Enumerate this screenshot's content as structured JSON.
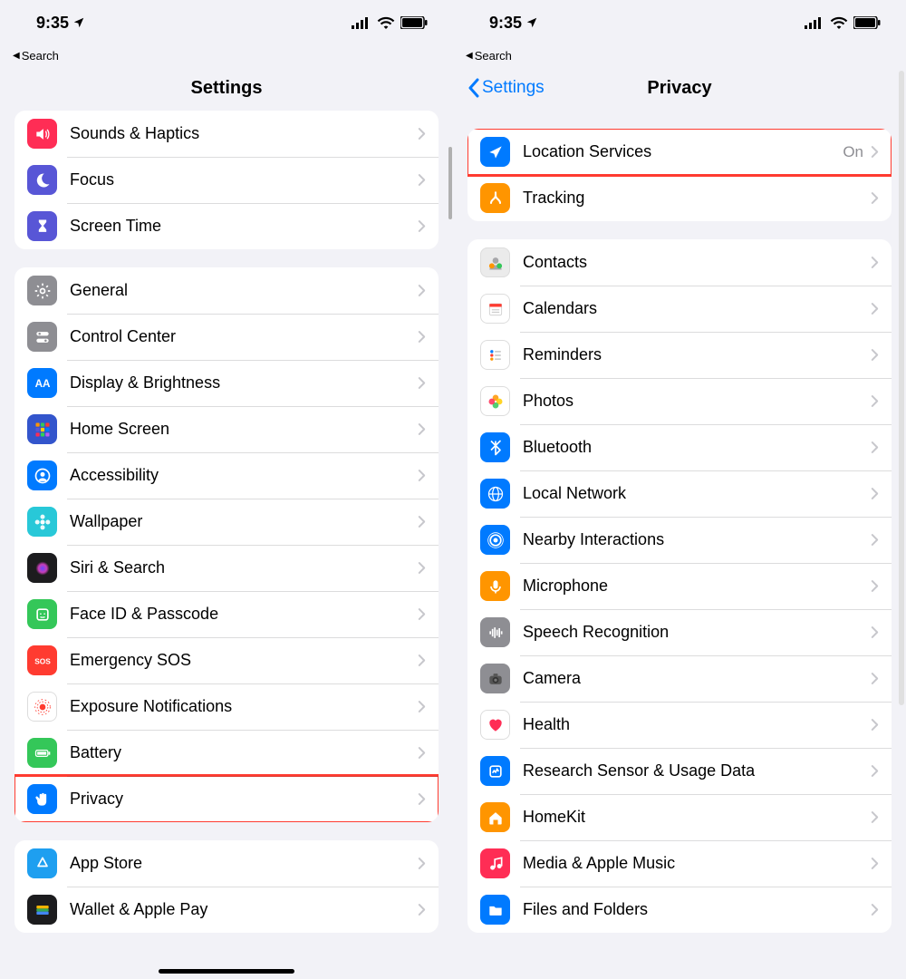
{
  "status": {
    "time": "9:35",
    "back_search": "Search"
  },
  "left": {
    "title": "Settings",
    "groups": [
      {
        "rows": [
          {
            "id": "sounds-haptics",
            "label": "Sounds & Haptics",
            "icon_bg": "#ff2d55",
            "icon": "speaker"
          },
          {
            "id": "focus",
            "label": "Focus",
            "icon_bg": "#5856d6",
            "icon": "moon"
          },
          {
            "id": "screen-time",
            "label": "Screen Time",
            "icon_bg": "#5856d6",
            "icon": "hourglass"
          }
        ]
      },
      {
        "rows": [
          {
            "id": "general",
            "label": "General",
            "icon_bg": "#8e8e93",
            "icon": "gear"
          },
          {
            "id": "control-center",
            "label": "Control Center",
            "icon_bg": "#8e8e93",
            "icon": "toggles"
          },
          {
            "id": "display-brightness",
            "label": "Display & Brightness",
            "icon_bg": "#007aff",
            "icon": "aa"
          },
          {
            "id": "home-screen",
            "label": "Home Screen",
            "icon_bg": "#3355cc",
            "icon": "apps"
          },
          {
            "id": "accessibility",
            "label": "Accessibility",
            "icon_bg": "#007aff",
            "icon": "person-circle"
          },
          {
            "id": "wallpaper",
            "label": "Wallpaper",
            "icon_bg": "#28c8d8",
            "icon": "flower"
          },
          {
            "id": "siri-search",
            "label": "Siri & Search",
            "icon_bg": "#1c1c1e",
            "icon": "siri"
          },
          {
            "id": "faceid-passcode",
            "label": "Face ID & Passcode",
            "icon_bg": "#34c759",
            "icon": "face"
          },
          {
            "id": "emergency-sos",
            "label": "Emergency SOS",
            "icon_bg": "#ff3b30",
            "icon": "sos"
          },
          {
            "id": "exposure-notifications",
            "label": "Exposure Notifications",
            "icon_bg": "#ffffff",
            "icon": "exposure"
          },
          {
            "id": "battery",
            "label": "Battery",
            "icon_bg": "#34c759",
            "icon": "battery"
          },
          {
            "id": "privacy",
            "label": "Privacy",
            "icon_bg": "#007aff",
            "icon": "hand",
            "highlighted": true
          }
        ]
      },
      {
        "rows": [
          {
            "id": "app-store",
            "label": "App Store",
            "icon_bg": "#1e9ff0",
            "icon": "appstore"
          },
          {
            "id": "wallet-applepay",
            "label": "Wallet & Apple Pay",
            "icon_bg": "#1c1c1e",
            "icon": "wallet"
          }
        ]
      }
    ]
  },
  "right": {
    "title": "Privacy",
    "back_label": "Settings",
    "groups": [
      {
        "rows": [
          {
            "id": "location-services",
            "label": "Location Services",
            "value": "On",
            "icon_bg": "#007aff",
            "icon": "location",
            "highlighted": true
          },
          {
            "id": "tracking",
            "label": "Tracking",
            "icon_bg": "#ff9500",
            "icon": "tracking"
          }
        ]
      },
      {
        "rows": [
          {
            "id": "contacts",
            "label": "Contacts",
            "icon_bg": "#ebebeb",
            "icon": "contacts"
          },
          {
            "id": "calendars",
            "label": "Calendars",
            "icon_bg": "#ffffff",
            "icon": "calendar"
          },
          {
            "id": "reminders",
            "label": "Reminders",
            "icon_bg": "#ffffff",
            "icon": "reminders"
          },
          {
            "id": "photos",
            "label": "Photos",
            "icon_bg": "#ffffff",
            "icon": "photos"
          },
          {
            "id": "bluetooth",
            "label": "Bluetooth",
            "icon_bg": "#007aff",
            "icon": "bluetooth"
          },
          {
            "id": "local-network",
            "label": "Local Network",
            "icon_bg": "#007aff",
            "icon": "globe"
          },
          {
            "id": "nearby-interactions",
            "label": "Nearby Interactions",
            "icon_bg": "#007aff",
            "icon": "nearby"
          },
          {
            "id": "microphone",
            "label": "Microphone",
            "icon_bg": "#ff9500",
            "icon": "mic"
          },
          {
            "id": "speech-recognition",
            "label": "Speech Recognition",
            "icon_bg": "#8e8e93",
            "icon": "wave"
          },
          {
            "id": "camera",
            "label": "Camera",
            "icon_bg": "#8e8e93",
            "icon": "camera"
          },
          {
            "id": "health",
            "label": "Health",
            "icon_bg": "#ffffff",
            "icon": "heart"
          },
          {
            "id": "research-sensor",
            "label": "Research Sensor & Usage Data",
            "icon_bg": "#007aff",
            "icon": "research"
          },
          {
            "id": "homekit",
            "label": "HomeKit",
            "icon_bg": "#ff9500",
            "icon": "home"
          },
          {
            "id": "media-applemusic",
            "label": "Media & Apple Music",
            "icon_bg": "#ff2d55",
            "icon": "music"
          },
          {
            "id": "files-folders",
            "label": "Files and Folders",
            "icon_bg": "#007aff",
            "icon": "folder"
          }
        ]
      }
    ]
  }
}
